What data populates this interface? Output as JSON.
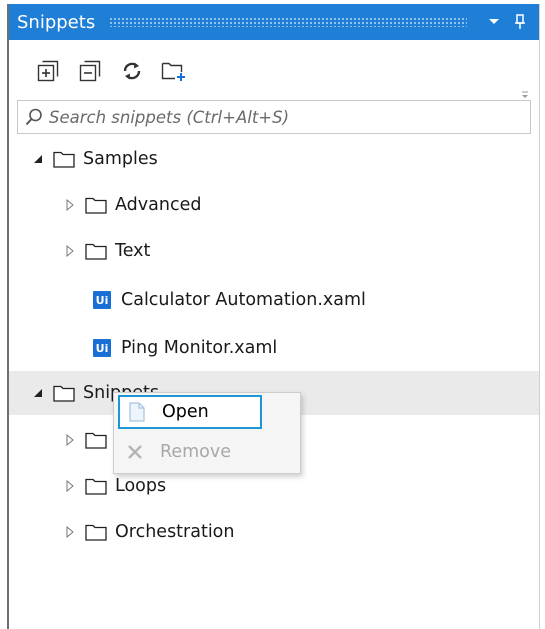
{
  "panel": {
    "title": "Snippets",
    "dropdown_icon": "chevron-down-icon",
    "pin_icon": "pin-icon"
  },
  "toolbar": {
    "buttons": [
      {
        "name": "expand-all-icon"
      },
      {
        "name": "collapse-all-icon"
      },
      {
        "name": "refresh-icon"
      },
      {
        "name": "add-folder-icon"
      }
    ]
  },
  "search": {
    "placeholder": "Search snippets (Ctrl+Alt+S)",
    "value": ""
  },
  "tree": {
    "samples": {
      "label": "Samples",
      "children": [
        {
          "label": "Advanced"
        },
        {
          "label": "Text"
        },
        {
          "label": "Calculator Automation.xaml",
          "badge": "Ui"
        },
        {
          "label": "Ping Monitor.xaml",
          "badge": "Ui"
        }
      ]
    },
    "snippets": {
      "label": "Snippets",
      "children": [
        {
          "label": ""
        },
        {
          "label": "Loops"
        },
        {
          "label": "Orchestration"
        }
      ]
    }
  },
  "context_menu": {
    "items": [
      {
        "label": "Open",
        "enabled": true
      },
      {
        "label": "Remove",
        "enabled": false
      }
    ]
  },
  "colors": {
    "accent": "#1f7fd6",
    "highlight_border": "#1e96d6",
    "ui_badge": "#1a6fd6"
  }
}
